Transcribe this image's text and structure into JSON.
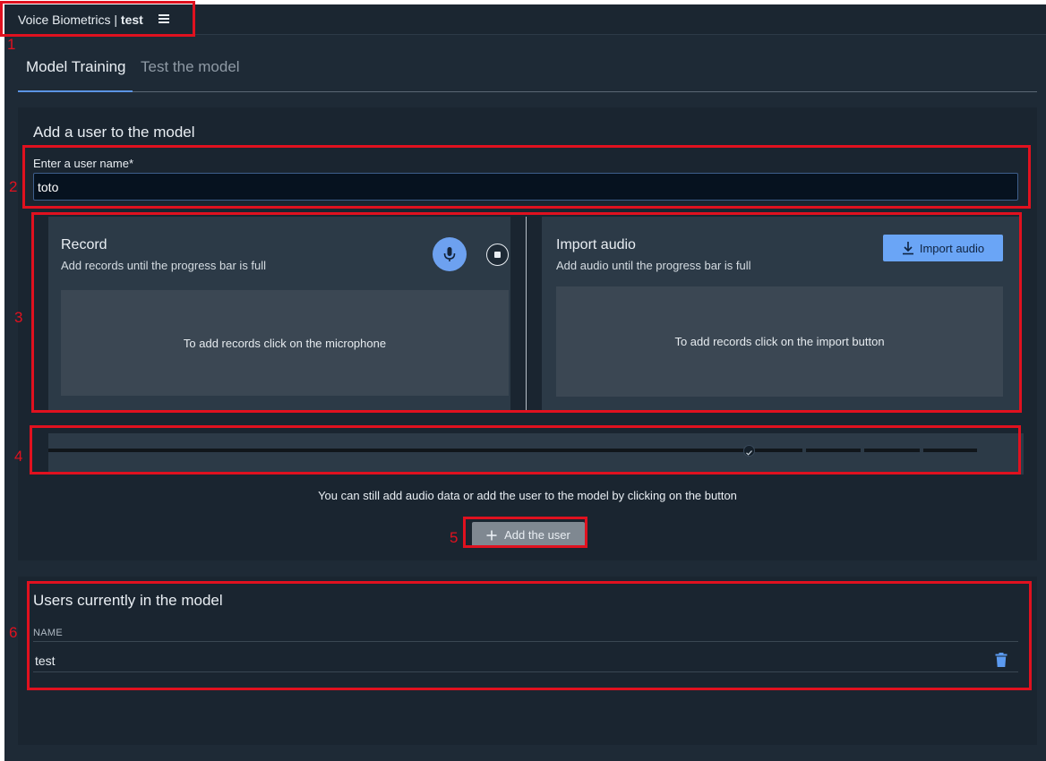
{
  "header": {
    "app_name": "Voice Biometrics",
    "separator": "|",
    "project": "test",
    "menu_icon": "hamburger-menu-icon"
  },
  "tabs": [
    {
      "label": "Model Training",
      "active": true
    },
    {
      "label": "Test the model",
      "active": false
    }
  ],
  "add_user": {
    "title": "Add a user to the model",
    "field_label": "Enter a user name*",
    "field_value": "toto"
  },
  "record": {
    "title": "Record",
    "subtitle": "Add records until the progress bar is full",
    "drop_text": "To add records click on the microphone",
    "mic_icon": "microphone-icon",
    "stop_icon": "stop-icon"
  },
  "import": {
    "title": "Import audio",
    "subtitle": "Add audio until the progress bar is full",
    "button_label": "Import audio",
    "button_icon": "download-icon",
    "drop_text": "To add records click on the import button"
  },
  "progress": {
    "segments_total": 4,
    "segments_filled": 1,
    "status_icon": "check-icon"
  },
  "info_text": "You can still add audio data or add the user to the model by clicking on the button",
  "add_button": {
    "label": "Add the user",
    "icon": "plus-icon"
  },
  "users": {
    "title": "Users currently in the model",
    "column_header": "NAME",
    "rows": [
      {
        "name": "test"
      }
    ],
    "delete_icon": "trash-icon"
  },
  "annotations": [
    "1",
    "2",
    "3",
    "4",
    "5",
    "6"
  ],
  "colors": {
    "background": "#1e2a36",
    "card": "#1a2530",
    "panel": "#2c3a47",
    "accent": "#6aa5f6",
    "annotation": "#e0111f"
  }
}
